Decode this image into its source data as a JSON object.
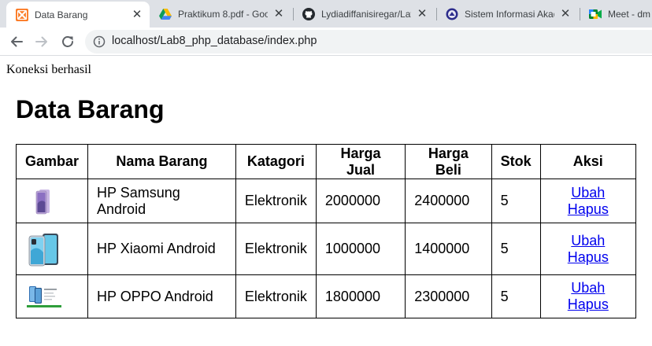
{
  "browser": {
    "tabs": [
      {
        "title": "Data Barang",
        "icon": "xampp-icon",
        "active": true
      },
      {
        "title": "Praktikum 8.pdf - Goo",
        "icon": "google-drive-icon",
        "active": false
      },
      {
        "title": "Lydiadiffanisiregar/Lat",
        "icon": "github-icon",
        "active": false
      },
      {
        "title": "Sistem Informasi Akad",
        "icon": "university-icon",
        "active": false
      },
      {
        "title": "Meet - dm",
        "icon": "google-meet-icon",
        "active": false
      }
    ],
    "url": "localhost/Lab8_php_database/index.php"
  },
  "page": {
    "status": "Koneksi berhasil",
    "title": "Data Barang",
    "columns": [
      "Gambar",
      "Nama Barang",
      "Katagori",
      "Harga Jual",
      "Harga Beli",
      "Stok",
      "Aksi"
    ],
    "rows": [
      {
        "image": "phone-samsung-thumbnail",
        "nama": "HP Samsung Android",
        "kategori": "Elektronik",
        "harga_jual": "2000000",
        "harga_beli": "2400000",
        "stok": "5",
        "ubah": "Ubah",
        "hapus": "Hapus"
      },
      {
        "image": "phone-xiaomi-thumbnail",
        "nama": "HP Xiaomi Android",
        "kategori": "Elektronik",
        "harga_jual": "1000000",
        "harga_beli": "1400000",
        "stok": "5",
        "ubah": "Ubah",
        "hapus": "Hapus"
      },
      {
        "image": "phone-oppo-thumbnail",
        "nama": "HP OPPO Android",
        "kategori": "Elektronik",
        "harga_jual": "1800000",
        "harga_beli": "2300000",
        "stok": "5",
        "ubah": "Ubah",
        "hapus": "Hapus"
      }
    ]
  },
  "colors": {
    "link": "#0000ee",
    "tabbar": "#dee1e6",
    "omnibox": "#f1f3f4"
  }
}
